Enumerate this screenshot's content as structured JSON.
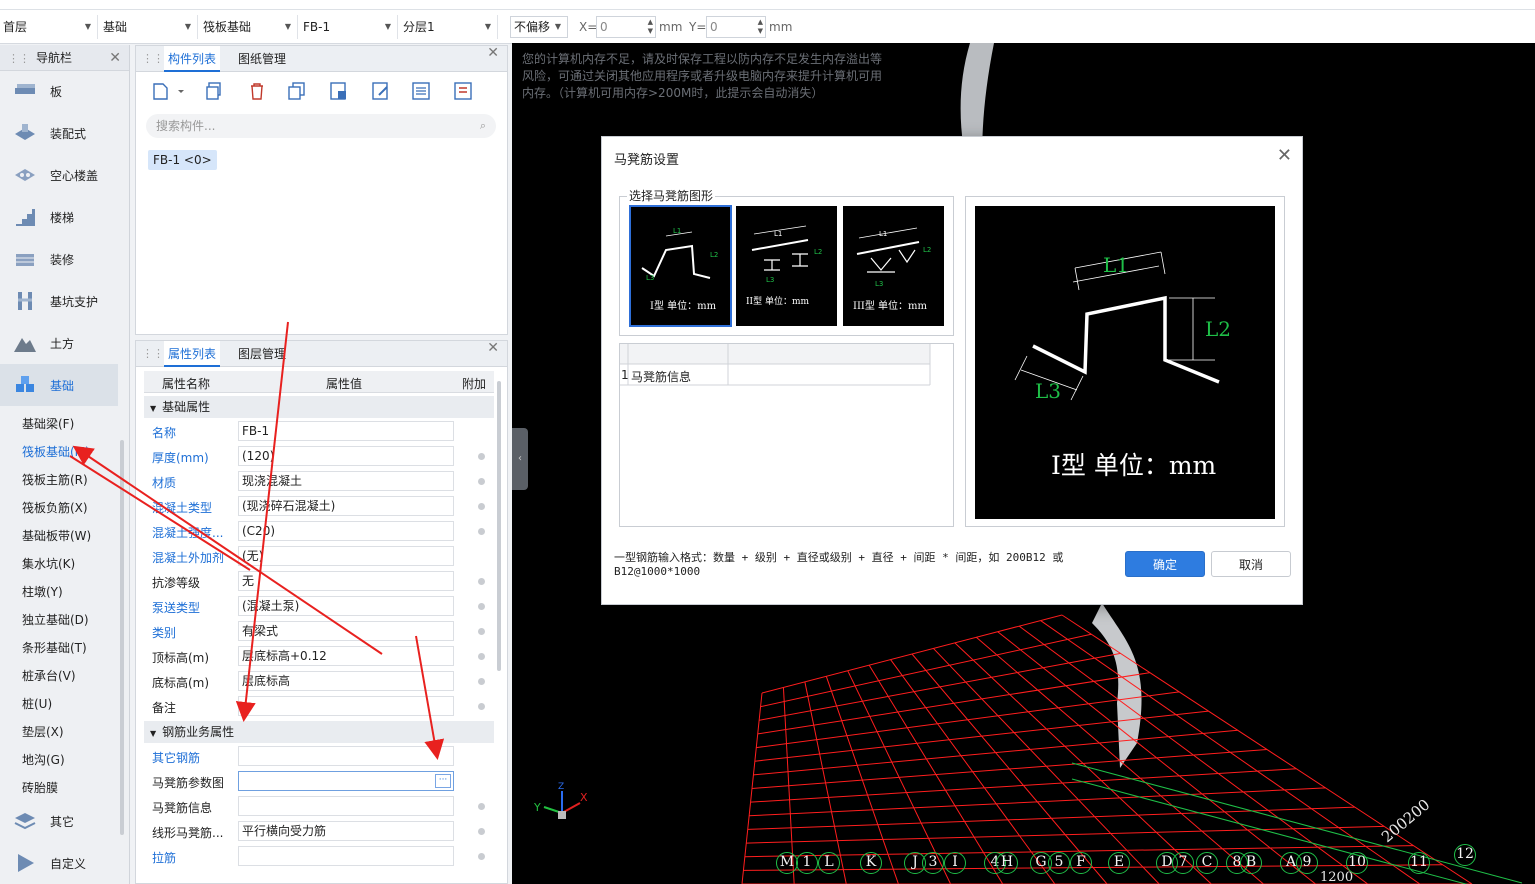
{
  "toolbar": {
    "floor": "首层",
    "category": "基础",
    "type": "筏板基础",
    "component": "FB-1",
    "layer": "分层1",
    "offset": "不偏移",
    "x_label": "X=",
    "x_value": "0",
    "y_label": "Y=",
    "y_value": "0",
    "unit": "mm"
  },
  "nav": {
    "title": "导航栏",
    "items": [
      {
        "label": "板",
        "icon": "slab-icon"
      },
      {
        "label": "装配式",
        "icon": "prefab-icon"
      },
      {
        "label": "空心楼盖",
        "icon": "hollow-floor-icon"
      },
      {
        "label": "楼梯",
        "icon": "stair-icon"
      },
      {
        "label": "装修",
        "icon": "decoration-icon"
      },
      {
        "label": "基坑支护",
        "icon": "pit-support-icon"
      },
      {
        "label": "土方",
        "icon": "earthwork-icon"
      },
      {
        "label": "基础",
        "icon": "foundation-icon"
      }
    ],
    "subitems": [
      "基础梁(F)",
      "筏板基础(M)",
      "筏板主筋(R)",
      "筏板负筋(X)",
      "基础板带(W)",
      "集水坑(K)",
      "柱墩(Y)",
      "独立基础(D)",
      "条形基础(T)",
      "桩承台(V)",
      "桩(U)",
      "垫层(X)",
      "地沟(G)",
      "砖胎膜"
    ],
    "bottom_items": [
      {
        "label": "其它",
        "icon": "other-icon"
      },
      {
        "label": "自定义",
        "icon": "custom-icon"
      }
    ]
  },
  "component_panel": {
    "tab1": "构件列表",
    "tab2": "图纸管理",
    "search_placeholder": "搜索构件...",
    "chip": "FB-1 <0>"
  },
  "property_panel": {
    "tab1": "属性列表",
    "tab2": "图层管理",
    "col_name": "属性名称",
    "col_value": "属性值",
    "col_extra": "附加",
    "group1": "基础属性",
    "rows1": [
      {
        "name": "名称",
        "value": "FB-1"
      },
      {
        "name": "厚度(mm)",
        "value": "(120)"
      },
      {
        "name": "材质",
        "value": "现浇混凝土"
      },
      {
        "name": "混凝土类型",
        "value": "(现浇碎石混凝土)"
      },
      {
        "name": "混凝土强度...",
        "value": "(C20)"
      },
      {
        "name": "混凝土外加剂",
        "value": "(无)"
      },
      {
        "name": "抗渗等级",
        "value": "无"
      },
      {
        "name": "泵送类型",
        "value": "(混凝土泵)"
      },
      {
        "name": "类别",
        "value": "有梁式"
      },
      {
        "name": "顶标高(m)",
        "value": "层底标高+0.12"
      },
      {
        "name": "底标高(m)",
        "value": "层底标高"
      },
      {
        "name": "备注",
        "value": ""
      }
    ],
    "group2": "钢筋业务属性",
    "rows2": [
      {
        "name": "其它钢筋",
        "value": ""
      },
      {
        "name": "马凳筋参数图",
        "value": ""
      },
      {
        "name": "马凳筋信息",
        "value": ""
      },
      {
        "name": "线形马凳筋...",
        "value": "平行横向受力筋"
      },
      {
        "name": "拉筋",
        "value": ""
      }
    ]
  },
  "viewport": {
    "warning": "您的计算机内存不足，请及时保存工程以防内存不足发生内存溢出等风险，可通过关闭其他应用程序或者升级电脑内存来提升计算机可用内存。（计算机可用内存>200M时，此提示会自动消失）",
    "axis_x": "X",
    "axis_y": "Y",
    "axis_z": "Z",
    "grid_labels": [
      "M",
      "1",
      "L",
      "K",
      "J",
      "3",
      "I",
      "4",
      "H",
      "G",
      "5",
      "F",
      "E",
      "D",
      "7",
      "C",
      "8",
      "B",
      "A",
      "9",
      "10",
      "11",
      "12"
    ],
    "dim_text": "200200",
    "dim_text2": "1200"
  },
  "dialog": {
    "title": "马凳筋设置",
    "section": "选择马凳筋图形",
    "thumbs": [
      {
        "caption": "I型 单位：mm"
      },
      {
        "caption": "II型 单位：mm"
      },
      {
        "caption": "III型 单位：mm"
      }
    ],
    "grid_row_no": "1",
    "grid_row_label": "马凳筋信息",
    "preview_labels": {
      "l1": "L1",
      "l2": "L2",
      "l3": "L3"
    },
    "preview_caption": "I型 单位：mm",
    "hint": "一型钢筋输入格式：数量 + 级别 + 直径或级别 + 直径 + 间距 * 间距，如 200B12 或 B12@1000*1000",
    "ok": "确定",
    "cancel": "取消"
  },
  "colors": {
    "accent": "#1e6fd6",
    "grid": "#ff1e1e",
    "dim_green": "#1fbf48",
    "arrow_red": "#e8211f"
  }
}
